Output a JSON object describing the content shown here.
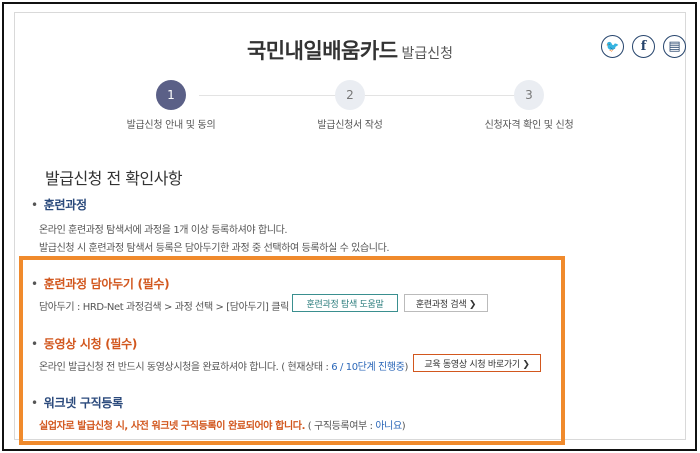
{
  "header": {
    "title": "국민내일배움카드",
    "subtitle": "발급신청"
  },
  "share": {
    "twitter_icon": "twitter-icon",
    "facebook_icon": "facebook-icon",
    "print_icon": "print-icon",
    "twitter_glyph": "🐦",
    "facebook_glyph": "f",
    "print_glyph": "▤"
  },
  "steps": [
    {
      "number": "1",
      "label": "발급신청 안내 및 동의",
      "active": true
    },
    {
      "number": "2",
      "label": "발급신청서 작성",
      "active": false
    },
    {
      "number": "3",
      "label": "신청자격 확인 및 신청",
      "active": false
    }
  ],
  "section_title": "발급신청 전 확인사항",
  "bullet": "•",
  "items": {
    "course": {
      "title": "훈련과정",
      "line1": "온라인 훈련과정 탐색서에 과정을 1개 이상 등록하셔야 합니다.",
      "line2": "발급신청 시 훈련과정 탐색서 등록은 담아두기한 과정 중 선택하여 등록하실 수 있습니다."
    },
    "cart": {
      "title": "훈련과정 담아두기 (필수)",
      "desc": "담아두기 : HRD-Net 과정검색 > 과정 선택 > [담아두기] 클릭",
      "help_button": "훈련과정 탐색 도움말",
      "search_button": "훈련과정 검색 ❯"
    },
    "video": {
      "title": "동영상 시청 (필수)",
      "desc": "온라인 발급신청 전 반드시 동영상시청을 완료하셔야 합니다. ( 현재상태 : ",
      "status": "6 / 10단계 진행중",
      "desc_end": ")",
      "button": "교육 동영상 시청 바로가기 ❯"
    },
    "worknet": {
      "title": "워크넷 구직등록",
      "warning": "실업자로 발급신청 시, 사전 워크넷 구직등록이 완료되어야 합니다.",
      "status_prefix": " ( 구직등록여부 : ",
      "status": "아니요",
      "status_suffix": ")"
    }
  },
  "colors": {
    "highlight_border": "#f08a2c",
    "active_step": "#5b6087",
    "accent_blue": "#2b4a7c",
    "accent_orange": "#d2571e"
  }
}
